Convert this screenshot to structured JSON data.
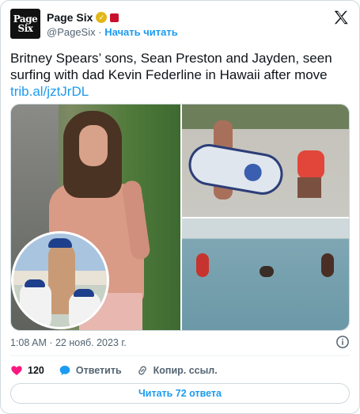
{
  "author": {
    "avatar_text_line1": "Page",
    "avatar_text_line2": "Six",
    "display_name": "Page Six",
    "handle": "@PageSix",
    "separator": "·",
    "follow_label": "Начать читать"
  },
  "tweet": {
    "text": "Britney Spears’ sons, Sean Preston and Jayden, seen surfing with dad Kevin Federline in Hawaii after move",
    "link": "trib.al/jztJrDL",
    "timestamp": "1:08 AM · 22 нояб. 2023 г."
  },
  "actions": {
    "like_count": "120",
    "reply_label": "Ответить",
    "copy_link_label": "Копир. ссыл."
  },
  "footer": {
    "read_replies_label": "Читать 72 ответа"
  },
  "colors": {
    "accent": "#1d9bf0",
    "like": "#f91880",
    "verified": "#e2b719"
  },
  "icons": [
    "verified-badge-icon",
    "x-logo-icon",
    "info-icon",
    "heart-icon",
    "reply-bubble-icon",
    "link-icon"
  ]
}
